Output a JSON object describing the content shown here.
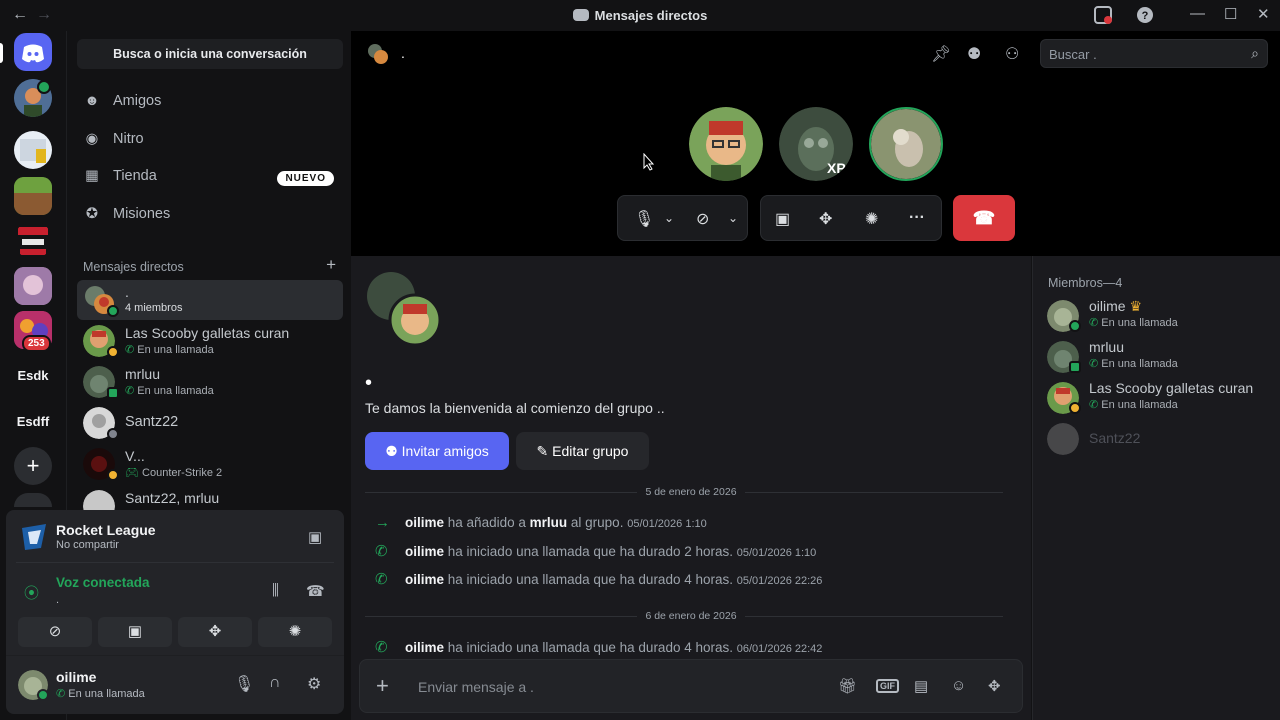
{
  "titlebar": {
    "title": "Mensajes directos",
    "back": "←",
    "forward": "→"
  },
  "rail": {
    "text_servers": [
      "Esdk",
      "Esdff"
    ],
    "badge": "253",
    "add": "+"
  },
  "sidebar": {
    "search": "Busca o inicia una conversación",
    "nav": [
      {
        "label": "Amigos",
        "icon": "friends-icon"
      },
      {
        "label": "Nitro",
        "icon": "nitro-icon"
      },
      {
        "label": "Tienda",
        "icon": "shop-icon",
        "badge": "NUEVO"
      },
      {
        "label": "Misiones",
        "icon": "quests-icon"
      }
    ],
    "dm_header": "Mensajes directos",
    "dms": [
      {
        "name": ".",
        "sub": "4 miembros"
      },
      {
        "name": "Las Scooby galletas curan",
        "sub": "En una llamada"
      },
      {
        "name": "mrluu",
        "sub": "En una llamada"
      },
      {
        "name": "Santz22",
        "sub": ""
      },
      {
        "name": "V...",
        "sub": "Counter-Strike 2"
      },
      {
        "name": "Santz22, mrluu",
        "sub": ""
      }
    ]
  },
  "panel": {
    "activity_name": "Rocket League",
    "activity_sub": "No compartir",
    "voice_status": "Voz conectada",
    "voice_channel": ".",
    "username": "oilime",
    "user_status": "En una llamada"
  },
  "call": {
    "channel": ".",
    "search_placeholder": "Buscar .",
    "avatar2_text": "XP"
  },
  "chat": {
    "welcome_title": "•",
    "welcome": "Te damos la bienvenida al comienzo del grupo ..",
    "invite": "Invitar amigos",
    "edit": "Editar grupo",
    "date1": "5 de enero de 2026",
    "date2": "6 de enero de 2026",
    "messages": [
      {
        "user": "oilime",
        "pre": "ha añadido a",
        "target": "mrluu",
        "post": "al grupo.",
        "ts": "05/01/2026 1:10"
      },
      {
        "user": "oilime",
        "text": "ha iniciado una llamada que ha durado 2 horas.",
        "ts": "05/01/2026 1:10"
      },
      {
        "user": "oilime",
        "text": "ha iniciado una llamada que ha durado 4 horas.",
        "ts": "05/01/2026 22:26"
      },
      {
        "user": "oilime",
        "text": "ha iniciado una llamada que ha durado 4 horas.",
        "ts": "06/01/2026 22:42"
      }
    ],
    "composer_placeholder": "Enviar mensaje a .",
    "gif": "GIF"
  },
  "members": {
    "header": "Miembros—4",
    "list": [
      {
        "name": "oilime",
        "sub": "En una llamada",
        "crown": "♛"
      },
      {
        "name": "mrluu",
        "sub": "En una llamada"
      },
      {
        "name": "Las Scooby galletas curan",
        "sub": "En una llamada"
      },
      {
        "name": "Santz22",
        "sub": ""
      }
    ]
  },
  "colors": {
    "accent": "#5865f2",
    "online": "#23a55a",
    "danger": "#da373c",
    "bg": "#121214",
    "chat_bg": "#1a1a1e"
  }
}
